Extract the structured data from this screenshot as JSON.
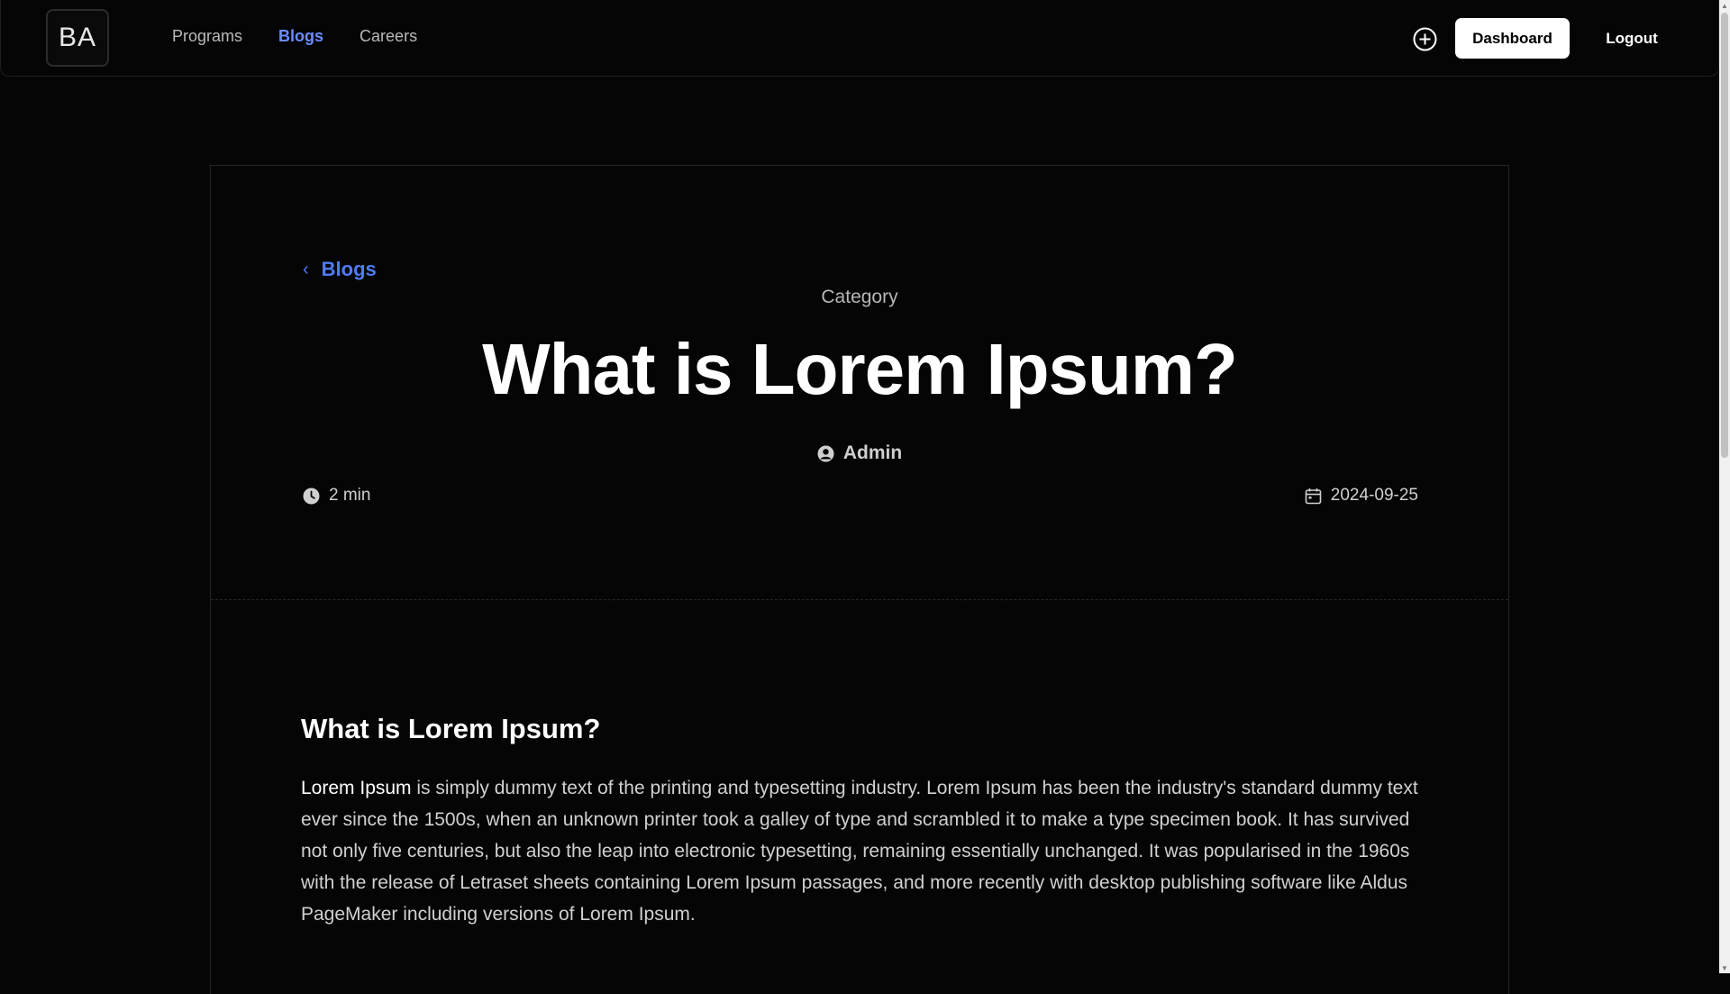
{
  "nav": {
    "logo": "BA",
    "links": [
      "Programs",
      "Blogs",
      "Careers"
    ],
    "active_index": 1,
    "dashboard_label": "Dashboard",
    "logout_label": "Logout",
    "add_icon": "plus-circle-icon"
  },
  "article": {
    "back_label": "Blogs",
    "category": "Category",
    "title": "What is Lorem Ipsum?",
    "author": "Admin",
    "read_time": "2 min",
    "date": "2024-09-25",
    "body": {
      "heading": "What is Lorem Ipsum?",
      "lead_term": "Lorem Ipsum",
      "paragraph_rest": " is simply dummy text of the printing and typesetting industry. Lorem Ipsum has been the industry's standard dummy text ever since the 1500s, when an unknown printer took a galley of type and scrambled it to make a type specimen book. It has survived not only five centuries, but also the leap into electronic typesetting, remaining essentially unchanged. It was popularised in the 1960s with the release of Letraset sheets containing Lorem Ipsum passages, and more recently with desktop publishing software like Aldus PageMaker including versions of Lorem Ipsum."
    }
  },
  "colors": {
    "background": "#050505",
    "accent": "#4f7cf7",
    "nav_active": "#6c8cff",
    "text_muted": "#b7b7b7"
  }
}
